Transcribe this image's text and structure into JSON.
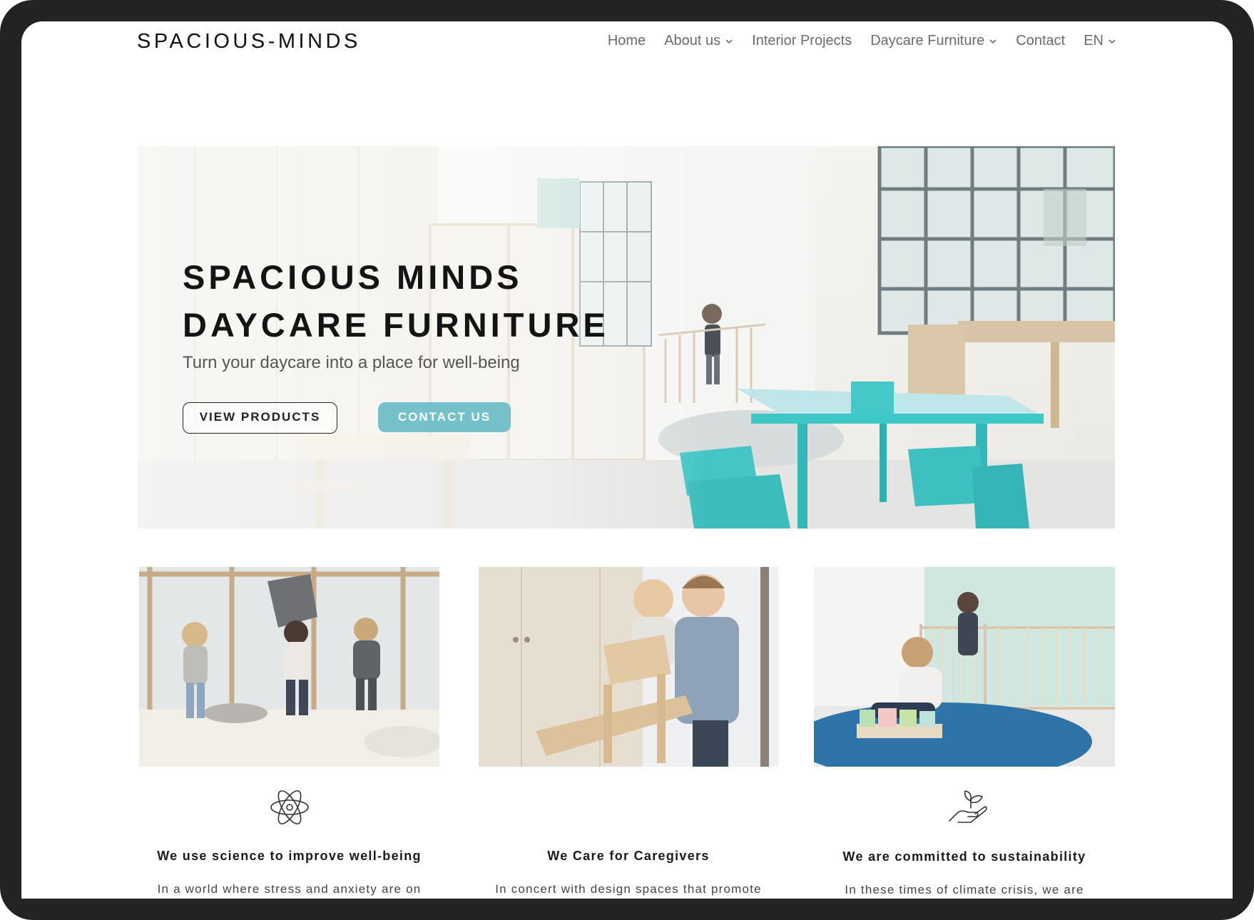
{
  "header": {
    "logo": "SPACIOUS-MINDS",
    "nav": [
      {
        "label": "Home",
        "has_dropdown": false
      },
      {
        "label": "About us",
        "has_dropdown": true
      },
      {
        "label": "Interior Projects",
        "has_dropdown": false
      },
      {
        "label": "Daycare Furniture",
        "has_dropdown": true
      },
      {
        "label": "Contact",
        "has_dropdown": false
      },
      {
        "label": "EN",
        "has_dropdown": true
      }
    ]
  },
  "hero": {
    "title_line1": "SPACIOUS MINDS",
    "title_line2": "DAYCARE FURNITURE",
    "subtitle": "Turn your daycare into a place for well-being",
    "primary_button": "VIEW PRODUCTS",
    "secondary_button": "CONTACT US"
  },
  "features": [
    {
      "icon": "atom-icon",
      "title": "We use science to improve well-being",
      "text": "In a world where stress and anxiety are on"
    },
    {
      "icon": "",
      "title": "We Care for Caregivers",
      "text": "In concert with design spaces that promote"
    },
    {
      "icon": "hand-plant-icon",
      "title": "We are committed to sustainability",
      "text": "In these times of climate crisis, we are"
    }
  ],
  "colors": {
    "accent": "#75c1c9",
    "turquoise_furniture": "#3fc6c6",
    "frame": "#232323",
    "nav_text": "#6b6b6b"
  }
}
